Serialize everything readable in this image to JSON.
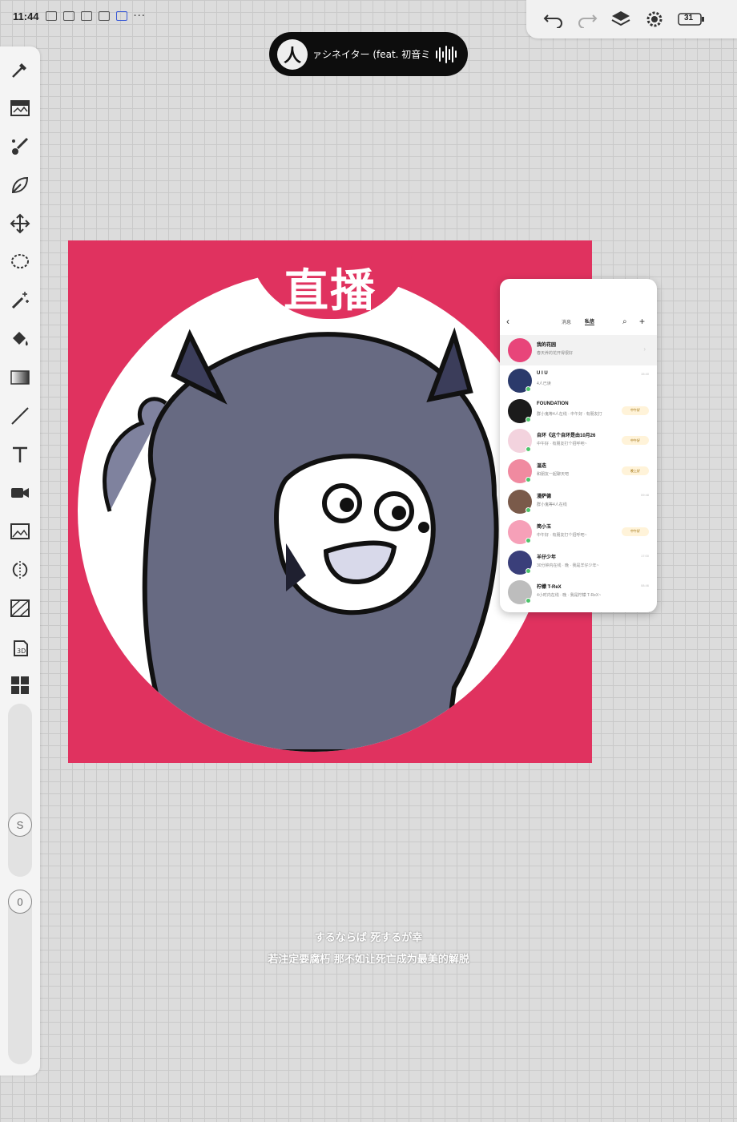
{
  "status_bar": {
    "time": "11:44",
    "more": "···"
  },
  "top_controls": {
    "battery": "31"
  },
  "now_playing": {
    "title": "ァシネイター (feat. 初音ミク)"
  },
  "canvas": {
    "title_text": "直播",
    "background_color": "#e0325f"
  },
  "phone_screenshot": {
    "tabs": [
      "消息",
      "私信"
    ],
    "active_tab": "私信",
    "chats": [
      {
        "name": "我的花园",
        "message": "春天养的花开得很好",
        "time": "",
        "badge": "",
        "avatar_color": "#e8457a"
      },
      {
        "name": "U I U",
        "message": "4人已读",
        "time": "15:40",
        "badge": "",
        "avatar_color": "#2b3a6b"
      },
      {
        "name": "FOUNDATION",
        "message": "群小鬼等4人在线 · 中午好 · 有朋友打",
        "time": "",
        "badge": "中午好",
        "avatar_color": "#1b1b1b"
      },
      {
        "name": "自环《这个自环是由10月26",
        "message": "中午好 · 有朋友打个招呼吧~",
        "time": "",
        "badge": "中午好",
        "avatar_color": "#f3d3de"
      },
      {
        "name": "温迭",
        "message": "和朋友一起聊天吧",
        "time": "",
        "badge": "晚上好",
        "avatar_color": "#f08aa0"
      },
      {
        "name": "漫萨德",
        "message": "群小鬼等4人在线",
        "time": "09:48",
        "badge": "",
        "avatar_color": "#7a5a4a"
      },
      {
        "name": "简小玉",
        "message": "中午好 · 有朋友打个招呼吧~",
        "time": "",
        "badge": "中午好",
        "avatar_color": "#f6a0b8"
      },
      {
        "name": "羊仔少年",
        "message": "30分钟内在线 · 晚 · 我是羊仔少年~",
        "time": "17:00",
        "badge": "",
        "avatar_color": "#3a3f7a"
      },
      {
        "name": "柠檬 T-ReX",
        "message": "4小时内在线 · 晚 · 我是柠檬 T-ReX~",
        "time": "08:46",
        "badge": "",
        "avatar_color": "#bdbdbd"
      }
    ]
  },
  "lyrics": {
    "line1": "するならば 死するが幸",
    "line2": "若注定要腐朽 那不如让死亡成为最美的解脱"
  },
  "tools": {
    "names": [
      "eyedropper",
      "layers-panel",
      "brush",
      "smudge",
      "transform",
      "lasso",
      "magic-wand",
      "fill-bucket",
      "gradient",
      "line",
      "text",
      "video",
      "image-import",
      "symmetry",
      "perspective",
      "3d",
      "grid-layout"
    ],
    "size_slider_label": "S",
    "opacity_slider_label": "0"
  }
}
